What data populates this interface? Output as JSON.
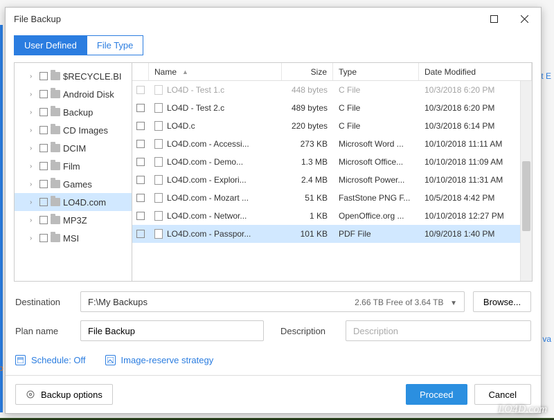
{
  "background": {
    "link_top": "t E",
    "link_mid": "va",
    "orange": "p"
  },
  "dialog": {
    "title": "File Backup"
  },
  "tabs": {
    "user_defined": "User Defined",
    "file_type": "File Type"
  },
  "tree": {
    "items": [
      {
        "label": "$RECYCLE.BI",
        "selected": false
      },
      {
        "label": "Android Disk",
        "selected": false
      },
      {
        "label": "Backup",
        "selected": false
      },
      {
        "label": "CD Images",
        "selected": false
      },
      {
        "label": "DCIM",
        "selected": false
      },
      {
        "label": "Film",
        "selected": false
      },
      {
        "label": "Games",
        "selected": false
      },
      {
        "label": "LO4D.com",
        "selected": true
      },
      {
        "label": "MP3Z",
        "selected": false
      },
      {
        "label": "MSI",
        "selected": false
      }
    ]
  },
  "grid": {
    "headers": {
      "name": "Name",
      "size": "Size",
      "type": "Type",
      "date": "Date Modified"
    },
    "rows": [
      {
        "name": "LO4D - Test 1.c",
        "size": "448 bytes",
        "type": "C File",
        "date": "10/3/2018 6:20 PM",
        "faded": true,
        "selected": false
      },
      {
        "name": "LO4D - Test 2.c",
        "size": "489 bytes",
        "type": "C File",
        "date": "10/3/2018 6:20 PM",
        "faded": false,
        "selected": false
      },
      {
        "name": "LO4D.c",
        "size": "220 bytes",
        "type": "C File",
        "date": "10/3/2018 6:14 PM",
        "faded": false,
        "selected": false
      },
      {
        "name": "LO4D.com - Accessi...",
        "size": "273 KB",
        "type": "Microsoft Word ...",
        "date": "10/10/2018 11:11 AM",
        "faded": false,
        "selected": false
      },
      {
        "name": "LO4D.com - Demo...",
        "size": "1.3 MB",
        "type": "Microsoft Office...",
        "date": "10/10/2018 11:09 AM",
        "faded": false,
        "selected": false
      },
      {
        "name": "LO4D.com - Explori...",
        "size": "2.4 MB",
        "type": "Microsoft Power...",
        "date": "10/10/2018 11:31 AM",
        "faded": false,
        "selected": false
      },
      {
        "name": "LO4D.com - Mozart ...",
        "size": "51 KB",
        "type": "FastStone PNG F...",
        "date": "10/5/2018 4:42 PM",
        "faded": false,
        "selected": false
      },
      {
        "name": "LO4D.com - Networ...",
        "size": "1 KB",
        "type": "OpenOffice.org ...",
        "date": "10/10/2018 12:27 PM",
        "faded": false,
        "selected": false
      },
      {
        "name": "LO4D.com - Passpor...",
        "size": "101 KB",
        "type": "PDF File",
        "date": "10/9/2018 1:40 PM",
        "faded": false,
        "selected": true
      }
    ]
  },
  "form": {
    "destination_label": "Destination",
    "destination_value": "F:\\My Backups",
    "free_space": "2.66 TB Free of 3.64 TB",
    "browse": "Browse...",
    "plan_name_label": "Plan name",
    "plan_name_value": "File Backup",
    "description_label": "Description",
    "description_placeholder": "Description"
  },
  "links": {
    "schedule": "Schedule: Off",
    "strategy": "Image-reserve strategy"
  },
  "actions": {
    "backup_options": "Backup options",
    "proceed": "Proceed",
    "cancel": "Cancel"
  },
  "watermark": "LO4D.com"
}
